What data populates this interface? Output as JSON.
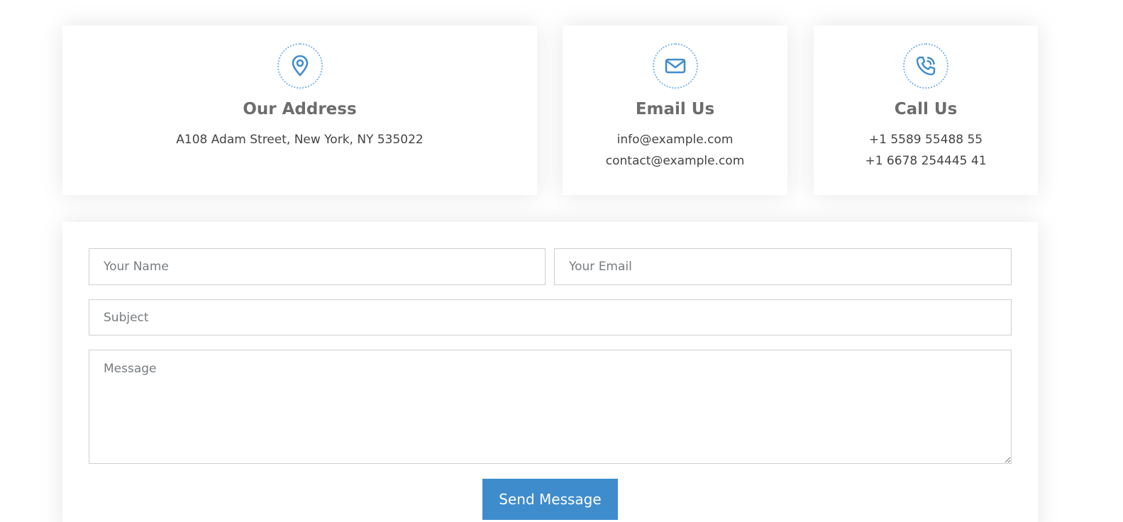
{
  "colors": {
    "accent": "#3f8ccd",
    "icon_ring": "#7fb6e6",
    "heading": "#6c6c6c",
    "text": "#444444"
  },
  "info_cards": {
    "address": {
      "icon": "map-pin-icon",
      "title": "Our Address",
      "lines": [
        "A108 Adam Street, New York, NY 535022"
      ]
    },
    "email": {
      "icon": "envelope-icon",
      "title": "Email Us",
      "lines": [
        "info@example.com",
        "contact@example.com"
      ]
    },
    "call": {
      "icon": "phone-call-icon",
      "title": "Call Us",
      "lines": [
        "+1 5589 55488 55",
        "+1 6678 254445 41"
      ]
    }
  },
  "form": {
    "name_placeholder": "Your Name",
    "email_placeholder": "Your Email",
    "subject_placeholder": "Subject",
    "message_placeholder": "Message",
    "submit_label": "Send Message"
  }
}
